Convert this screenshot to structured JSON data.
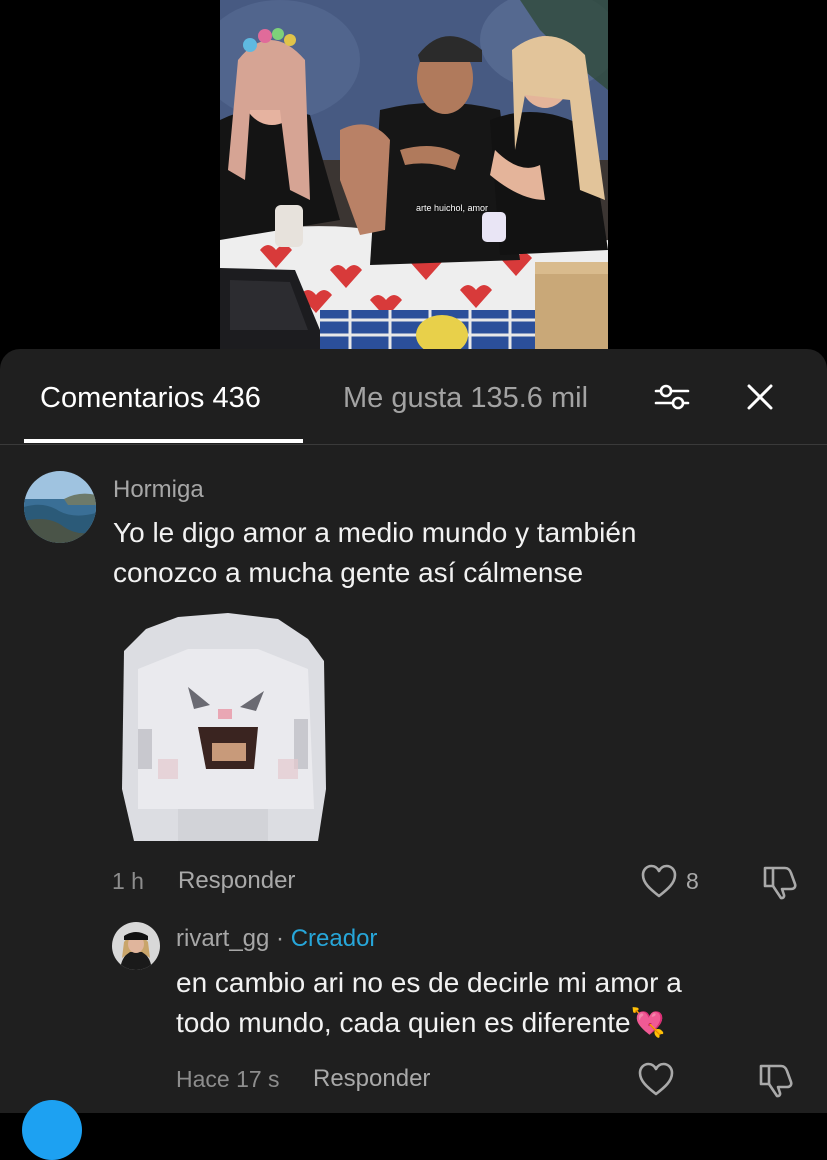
{
  "video": {
    "subtitle": "arte huichol, amor"
  },
  "tabs": {
    "comments_label": "Comentarios 436",
    "likes_label": "Me gusta 135.6 mil"
  },
  "comments": [
    {
      "username": "Hormiga",
      "text_line1": "Yo le digo amor a medio mundo y también",
      "text_line2": "conozco a mucha gente así cálmense",
      "time": "1 h",
      "reply_label": "Responder",
      "likes": "8"
    },
    {
      "username": "rivart_gg",
      "separator": "·",
      "creator_tag": "Creador",
      "text_line1": "en cambio ari no es de decirle mi amor a",
      "text_line2": "todo mundo, cada quien es diferente",
      "emoji": "💘",
      "time": "Hace 17 s",
      "reply_label": "Responder"
    }
  ],
  "icons": {
    "filter": "sliders-icon",
    "close": "close-icon",
    "like": "heart-outline-icon",
    "dislike": "thumbs-down-icon",
    "emoji": "heart-with-arrow-emoji"
  },
  "colors": {
    "sheet_bg": "#1f1f1f",
    "creator_accent": "#27a6d9",
    "muted_text": "#a7a7a7"
  }
}
